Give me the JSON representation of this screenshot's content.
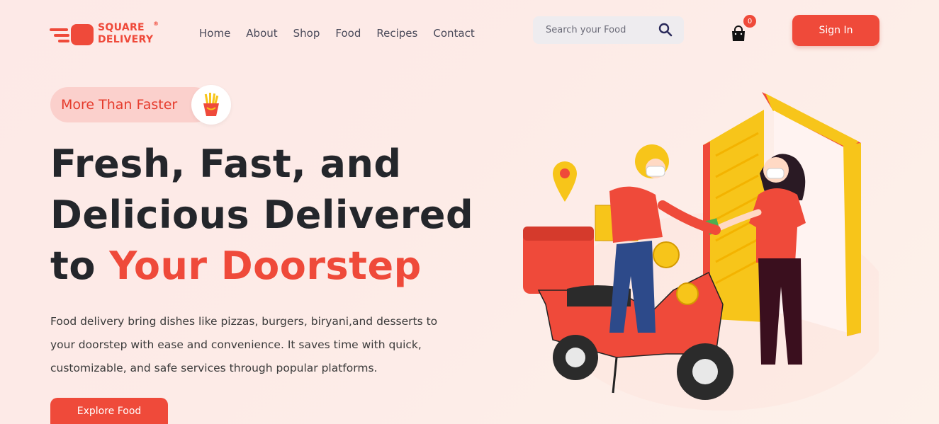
{
  "brand": {
    "line1": "SQUARE",
    "line2": "DELIVERY",
    "registered": "®"
  },
  "nav": {
    "items": [
      "Home",
      "About",
      "Shop",
      "Food",
      "Recipes",
      "Contact"
    ]
  },
  "search": {
    "placeholder": "Search your Food"
  },
  "cart": {
    "count": "0"
  },
  "header": {
    "signin_label": "Sign In"
  },
  "hero": {
    "tagline": "More Than Faster",
    "headline_line1": "Fresh, Fast, and",
    "headline_line2": "Delicious Delivered",
    "headline_to": "to ",
    "headline_accent": "Your Doorstep",
    "description": "Food delivery bring dishes like pizzas, burgers, biryani,and desserts to your doorstep with ease and convenience. It saves time with quick, customizable, and safe services through popular platforms.",
    "cta_label": "Explore Food"
  },
  "colors": {
    "accent": "#ef4a3a",
    "yellow": "#f7c51a",
    "dark": "#24262b"
  }
}
